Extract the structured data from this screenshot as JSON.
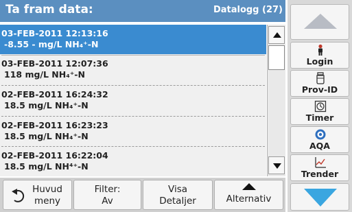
{
  "header": {
    "title": "Ta fram data:",
    "datalog_label": "Datalogg (27)"
  },
  "records": [
    {
      "datetime": "03-FEB-2011  12:13:16",
      "value": "-8.55  -  mg/L  NH₄⁺-N",
      "selected": true
    },
    {
      "datetime": "03-FEB-2011  12:07:36",
      "value": "118  mg/L  NH₄⁺-N",
      "selected": false
    },
    {
      "datetime": "02-FEB-2011  16:24:32",
      "value": "18.5  mg/L  NH₄⁺-N",
      "selected": false
    },
    {
      "datetime": "02-FEB-2011  16:23:23",
      "value": "18.5  mg/L  NH₄⁺-N",
      "selected": false
    },
    {
      "datetime": "02-FEB-2011  16:22:04",
      "value": "18.5  mg/L  NH⁴⁺-N",
      "selected": false
    }
  ],
  "sidebar": {
    "login": "Login",
    "prov_id": "Prov-ID",
    "timer": "Timer",
    "aqa": "AQA",
    "trender": "Trender"
  },
  "toolbar": {
    "main_menu_line1": "Huvud",
    "main_menu_line2": "meny",
    "filter_line1": "Filter:",
    "filter_line2": "Av",
    "details_line1": "Visa",
    "details_line2": "Detaljer",
    "options": "Alternativ"
  },
  "colors": {
    "title_bar": "#5b8fc0",
    "selected_row": "#3a8bd0",
    "scroll_down_arrow": "#3aa6e0"
  }
}
